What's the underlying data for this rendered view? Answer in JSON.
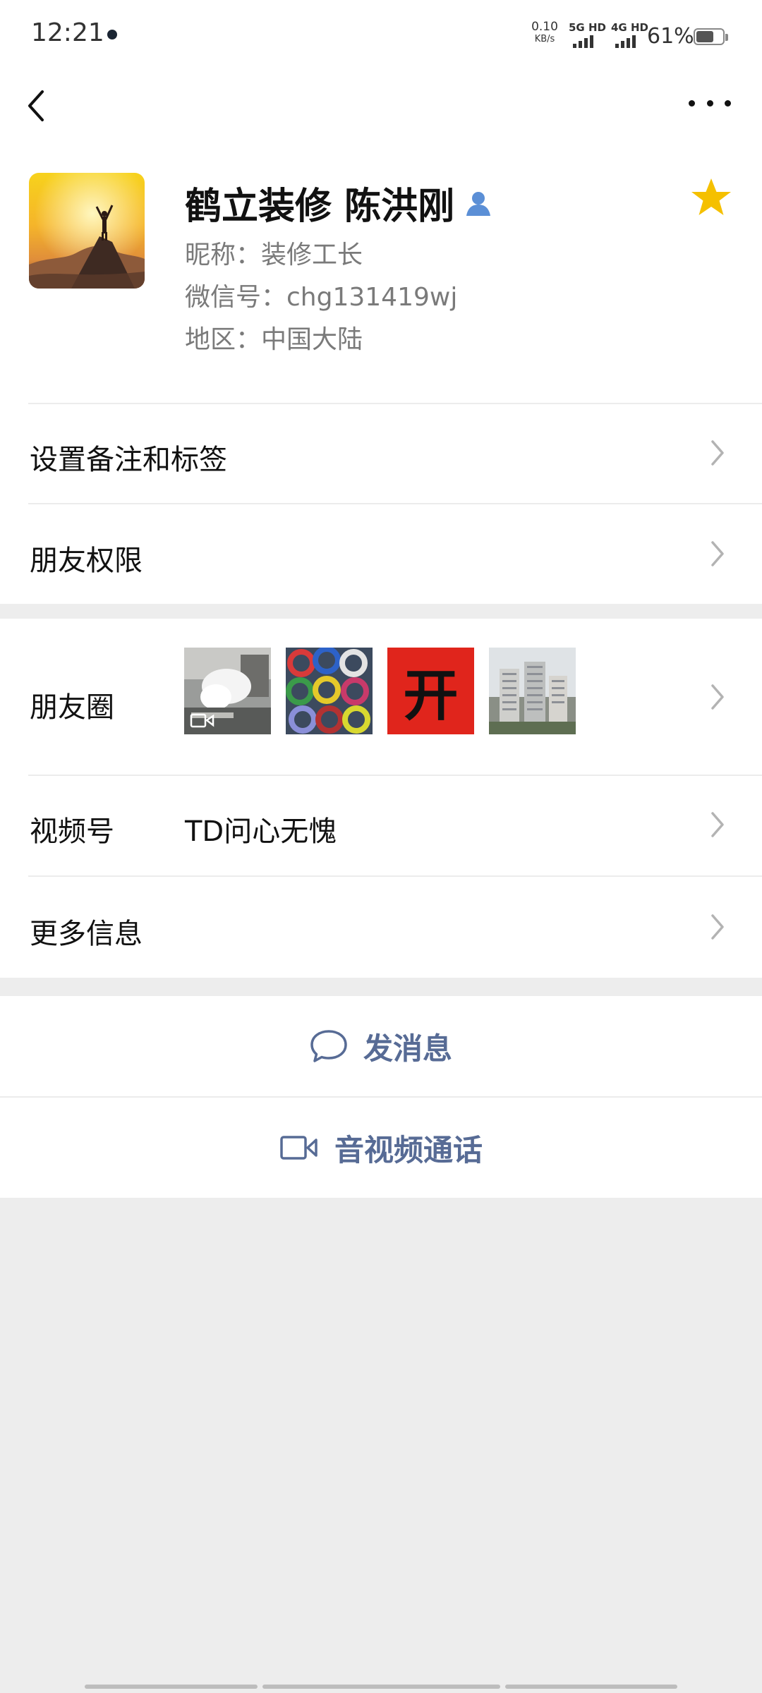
{
  "status_bar": {
    "time": "12:21",
    "speed_value": "0.10",
    "speed_unit": "KB/s",
    "sim1": "5G HD",
    "sim2": "4G HD",
    "battery": "61%",
    "battery_level": 0.61
  },
  "nav": {
    "back_icon": "chevron-left-icon",
    "more_icon": "more-dots-icon"
  },
  "profile": {
    "display_name": "鹤立装修 陈洪刚",
    "nickname": "昵称：装修工长",
    "wechat_id": "微信号：chg131419wj",
    "region": "地区：中国大陆",
    "starred": true,
    "colors": {
      "star": "#f5c000",
      "person_icon": "#5b8fd6"
    }
  },
  "menu": {
    "remark_tags": "设置备注和标签",
    "permissions": "朋友权限",
    "moments": "朋友圈",
    "channels_label": "视频号",
    "channels_value": "TD问心无愧",
    "more_info": "更多信息"
  },
  "moments_thumbs": [
    {
      "subject": "kitchen video",
      "overlay_icon": "video-icon"
    },
    {
      "subject": "colored cable coils"
    },
    {
      "subject": "red card with character",
      "character": "开"
    },
    {
      "subject": "apartment buildings"
    }
  ],
  "actions": {
    "message": "发消息",
    "av_call": "音视频通话"
  },
  "theme": {
    "link_color": "#576b95",
    "background": "#ededed"
  }
}
